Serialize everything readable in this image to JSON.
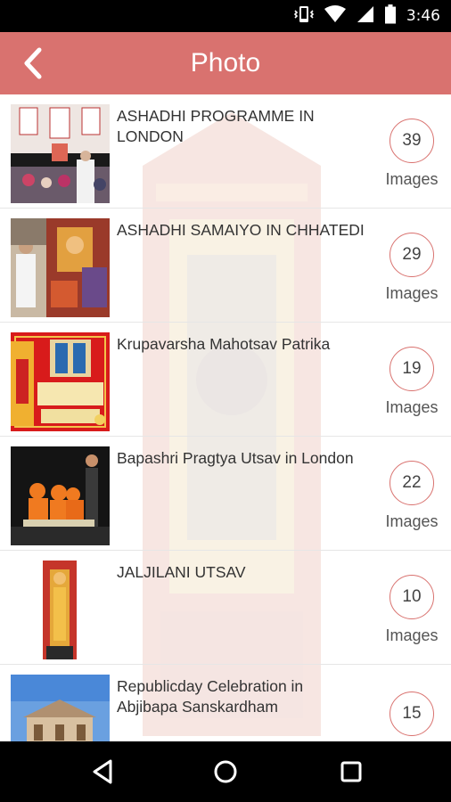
{
  "status_bar": {
    "time": "3:46",
    "icons": [
      "vibrate-icon",
      "wifi-icon",
      "signal-icon",
      "battery-icon"
    ]
  },
  "app_bar": {
    "title": "Photo",
    "back_icon": "back-arrow-icon",
    "color": "#d9726f"
  },
  "albums": [
    {
      "title": "ASHADHI PROGRAMME IN LONDON",
      "count": "39",
      "count_label": "Images"
    },
    {
      "title": "ASHADHI SAMAIYO IN CHHATEDI",
      "count": "29",
      "count_label": "Images"
    },
    {
      "title": "Krupavarsha Mahotsav Patrika",
      "count": "19",
      "count_label": "Images"
    },
    {
      "title": "Bapashri Pragtya Utsav in London",
      "count": "22",
      "count_label": "Images"
    },
    {
      "title": "JALJILANI UTSAV",
      "count": "10",
      "count_label": "Images"
    },
    {
      "title": "Republicday Celebration in Abjibapa Sanskardham",
      "count": "15",
      "count_label": "Images"
    }
  ],
  "nav_bar": {
    "buttons": [
      "back-triangle-icon",
      "home-circle-icon",
      "recents-square-icon"
    ]
  }
}
